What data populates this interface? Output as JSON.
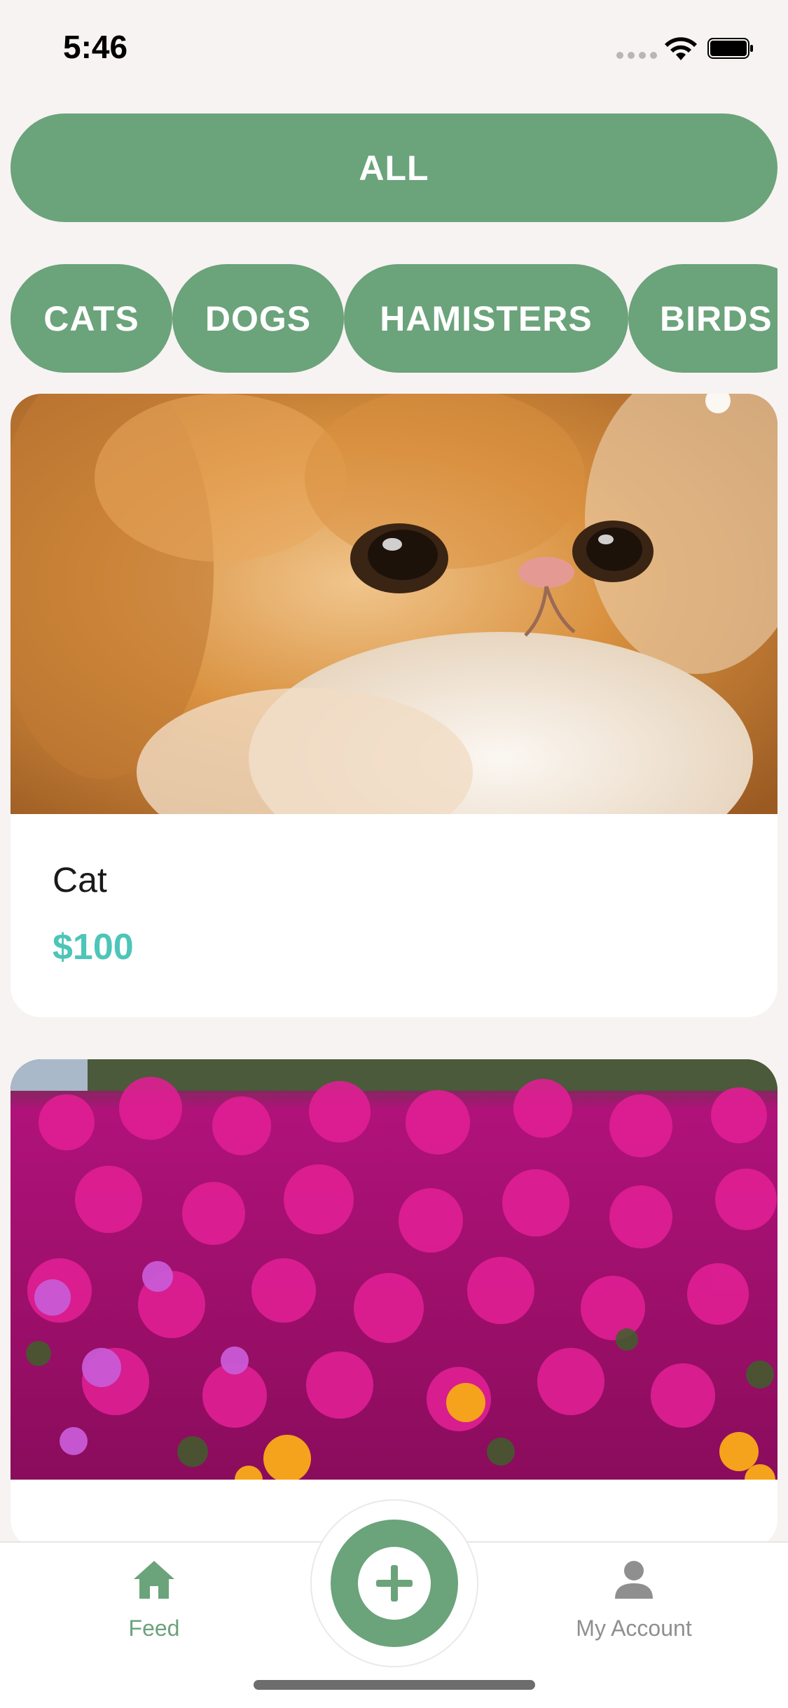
{
  "status_bar": {
    "time": "5:46"
  },
  "filters": {
    "all_label": "ALL",
    "categories": [
      "CATS",
      "DOGS",
      "HAMISTERS",
      "BIRDS"
    ]
  },
  "feed": [
    {
      "title": "Cat",
      "price": "$100",
      "image": "kitten-photo"
    },
    {
      "title": "",
      "price": "",
      "image": "pink-flowers-photo"
    }
  ],
  "tab_bar": {
    "feed_label": "Feed",
    "account_label": "My Account",
    "feed_icon": "home-icon",
    "account_icon": "person-icon",
    "add_icon": "plus-icon"
  },
  "colors": {
    "accent_green": "#6ba37b",
    "price_teal": "#4dc5b8",
    "background": "#f7f3f2"
  }
}
